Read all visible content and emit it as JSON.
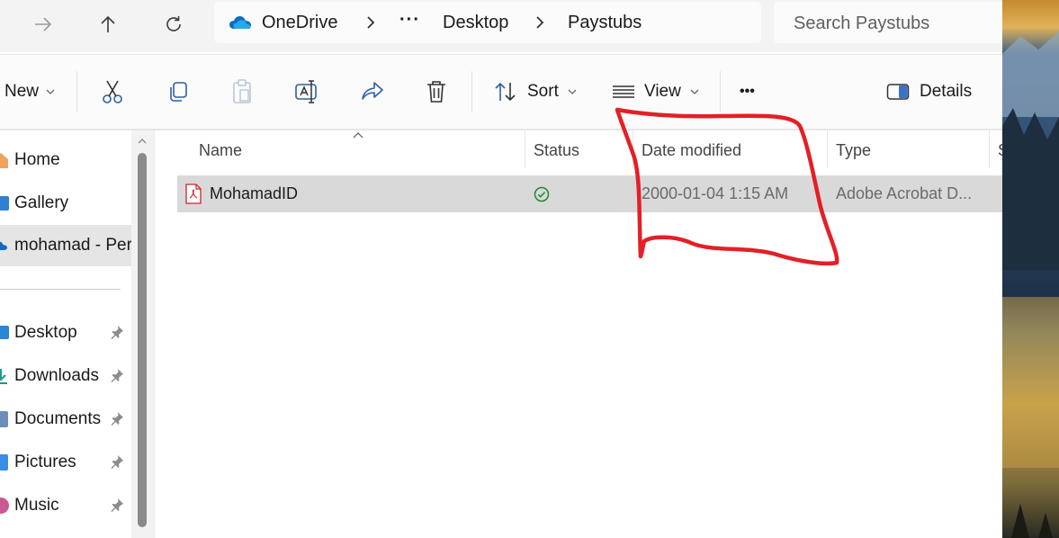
{
  "nav": {
    "back": "arrow-left-icon",
    "forward": "arrow-right-icon",
    "up": "arrow-up-icon",
    "refresh": "refresh-icon"
  },
  "breadcrumb": {
    "root": "OneDrive",
    "ellipsis": "···",
    "items": [
      "Desktop",
      "Paystubs"
    ]
  },
  "search": {
    "placeholder": "Search Paystubs"
  },
  "toolbar": {
    "new_label": "New",
    "sort_label": "Sort",
    "view_label": "View",
    "more_label": "•••",
    "details_label": "Details"
  },
  "sidebar": {
    "items": [
      {
        "label": "Home",
        "pinned": false
      },
      {
        "label": "Gallery",
        "pinned": false
      },
      {
        "label": "mohamad - Pers",
        "pinned": false,
        "selected": true
      },
      {
        "label": "Desktop",
        "pinned": true
      },
      {
        "label": "Downloads",
        "pinned": true
      },
      {
        "label": "Documents",
        "pinned": true
      },
      {
        "label": "Pictures",
        "pinned": true
      },
      {
        "label": "Music",
        "pinned": true
      }
    ]
  },
  "columns": {
    "name": "Name",
    "status": "Status",
    "date": "Date modified",
    "type": "Type",
    "size": "S"
  },
  "files": [
    {
      "name": "MohamadID",
      "status": "synced",
      "date": "2000-01-04 1:15 AM",
      "type": "Adobe Acrobat D..."
    }
  ],
  "colors": {
    "selected_row": "#d9d9d9",
    "onedrive_blue": "#0f6cbd",
    "annotation_red": "#e41f26",
    "status_green": "#1b8a2f"
  }
}
